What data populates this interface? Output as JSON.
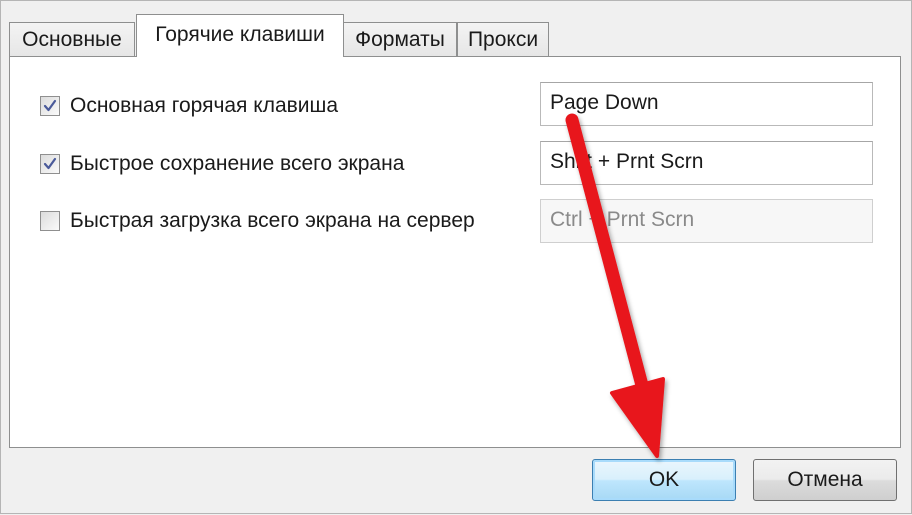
{
  "tabs": [
    {
      "label": "Основные",
      "active": false
    },
    {
      "label": "Горячие клавиши",
      "active": true
    },
    {
      "label": "Форматы",
      "active": false
    },
    {
      "label": "Прокси",
      "active": false
    }
  ],
  "hotkeys": [
    {
      "label": "Основная горячая клавиша",
      "checked": true,
      "value": "Page Down",
      "enabled": true
    },
    {
      "label": "Быстрое сохранение всего экрана",
      "checked": true,
      "value": "Shift + Prnt Scrn",
      "enabled": true
    },
    {
      "label": "Быстрая загрузка всего экрана на сервер",
      "checked": false,
      "value": "Ctrl + Prnt Scrn",
      "enabled": false
    }
  ],
  "buttons": {
    "ok": "OK",
    "cancel": "Отмена"
  },
  "colors": {
    "annotation_arrow": "#e8141c",
    "default_button_border": "#3c7fb1"
  }
}
